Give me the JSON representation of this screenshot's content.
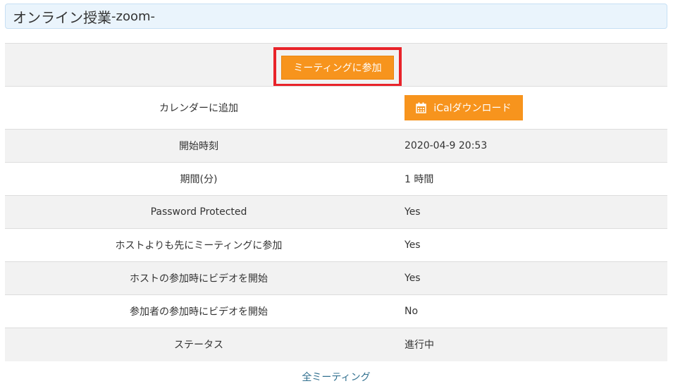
{
  "title": {
    "main": "オンライン授業",
    "suffix": "-zoom-"
  },
  "join_button": "ミーティングに参加",
  "rows": [
    {
      "label": "カレンダーに追加",
      "ical_button": "iCalダウンロード",
      "icon": "calendar-icon"
    },
    {
      "label": "開始時刻",
      "value": "2020-04-9 20:53"
    },
    {
      "label": "期間(分)",
      "value": "1 時間"
    },
    {
      "label": "Password Protected",
      "value": "Yes"
    },
    {
      "label": "ホストよりも先にミーティングに参加",
      "value": "Yes"
    },
    {
      "label": "ホストの参加時にビデオを開始",
      "value": "Yes"
    },
    {
      "label": "参加者の参加時にビデオを開始",
      "value": "No"
    },
    {
      "label": "ステータス",
      "value": "進行中"
    }
  ],
  "footer_link": "全ミーティング",
  "colors": {
    "accent_orange": "#f7941d",
    "highlight_red": "#e8232a",
    "title_bg": "#eaf4fc",
    "link": "#31708f"
  }
}
